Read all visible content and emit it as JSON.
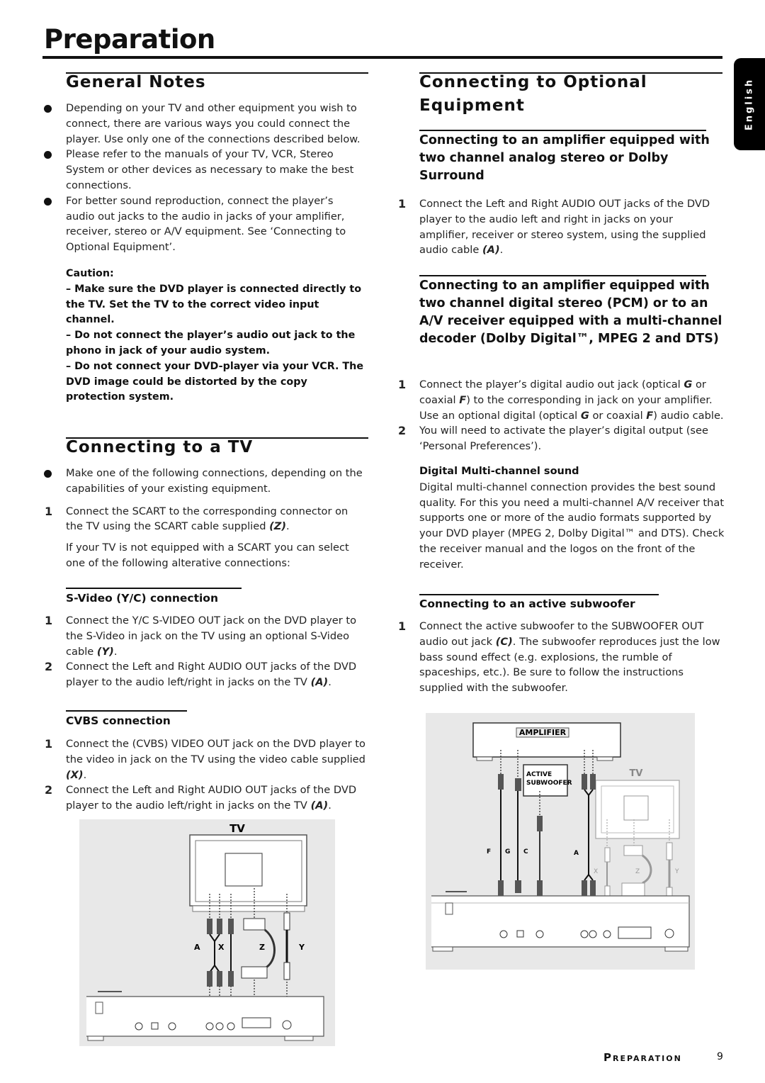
{
  "page": {
    "title": "Preparation",
    "language_tab": "English",
    "footer_section": "Preparation",
    "footer_page": "9"
  },
  "general_notes": {
    "heading": "General Notes",
    "bullets": [
      "Depending on your TV and other equipment you wish to connect, there are various ways you could connect the player. Use only one of the connections described below.",
      "Please refer to the manuals of your TV, VCR, Stereo System or other devices as necessary to make the best connections.",
      "For better sound reproduction, connect the player’s audio out jacks to the audio in jacks of your amplifier, receiver, stereo or A/V equipment.  See ‘Connecting to Optional Equipment’."
    ],
    "caution": {
      "label": "Caution:",
      "lines": [
        "– Make sure the DVD player is connected directly to the TV. Set the TV to the correct video input channel.",
        "–  Do not connect  the player’s audio out jack to the phono in jack of your audio system.",
        "–  Do not connect your DVD-player via your VCR. The DVD image could be distorted by the copy protection system."
      ]
    }
  },
  "connecting_tv": {
    "heading": "Connecting to a TV",
    "bullet": "Make one of the following connections, depending on the capabilities of your existing equipment.",
    "step1": {
      "num": "1",
      "text": "Connect the SCART to the corresponding connector on the TV using the SCART cable supplied ",
      "ref": "(Z)",
      "end": "."
    },
    "note": "If your TV is not equipped with a SCART you can select one of the following alterative connections:",
    "svideo": {
      "heading": "S-Video (Y/C) connection",
      "steps": [
        {
          "num": "1",
          "text": "Connect the Y/C S-VIDEO OUT jack on the DVD player to the S-Video in jack on the TV using an optional S-Video cable ",
          "ref": "(Y)",
          "end": "."
        },
        {
          "num": "2",
          "text": "Connect the Left and Right AUDIO OUT jacks of the DVD player to the audio left/right in jacks on the TV ",
          "ref": "(A)",
          "end": "."
        }
      ]
    },
    "cvbs": {
      "heading": "CVBS connection",
      "steps": [
        {
          "num": "1",
          "text": "Connect the (CVBS) VIDEO OUT jack on the DVD player to the video in jack on the TV using the video cable supplied ",
          "ref": "(X)",
          "end": "."
        },
        {
          "num": "2",
          "text": "Connect the Left and Right AUDIO OUT jacks of the DVD player to the audio left/right in jacks on the TV ",
          "ref": "(A)",
          "end": "."
        }
      ]
    },
    "diagram": {
      "tv_label": "TV",
      "cable_labels": [
        "A",
        "X",
        "Z",
        "Y"
      ]
    }
  },
  "optional_equipment": {
    "heading_line1": "Connecting to Optional",
    "heading_line2": "Equipment",
    "analog": {
      "heading": "Connecting to an amplifier equipped with two channel analog  stereo or Dolby Surround",
      "steps": [
        {
          "num": "1",
          "text": "Connect the Left and Right AUDIO OUT jacks of the DVD player to the audio left and right in jacks on your amplifier, receiver or stereo system, using the supplied audio cable ",
          "ref": "(A)",
          "end": "."
        }
      ]
    },
    "digital": {
      "heading": "Connecting to an amplifier equipped with two channel digital stereo (PCM) or to an A/V receiver equipped with a multi-channel decoder (Dolby Digital™, MPEG 2 and DTS)",
      "step1": {
        "num": "1",
        "a": "Connect the player’s digital audio out jack (optical ",
        "g1": "G",
        "b": " or coaxial ",
        "f1": "F",
        "c": ") to the corresponding in jack on your amplifier. Use an optional digital (optical ",
        "g2": "G",
        "d": " or coaxial ",
        "f2": "F",
        "e": ") audio cable."
      },
      "step2": {
        "num": "2",
        "text": "You will need to activate the player’s digital output (see ‘Personal Preferences’)."
      },
      "multichannel_heading": "Digital Multi-channel sound",
      "multichannel_text": "Digital multi-channel connection provides the best sound quality. For this you need a multi-channel A/V receiver that supports one or more of the audio formats supported by your DVD player (MPEG 2, Dolby Digital™ and DTS). Check the receiver manual and the logos on the front of the receiver."
    },
    "subwoofer": {
      "heading": "Connecting to an active subwoofer",
      "step1": {
        "num": "1",
        "a": "Connect the active subwoofer to the SUBWOOFER OUT audio out jack ",
        "ref": "(C)",
        "b": ". The subwoofer reproduces just the low bass sound effect (e.g. explosions, the rumble of spaceships, etc.). Be sure to follow the instructions supplied with the subwoofer."
      }
    },
    "diagram": {
      "amplifier_label": "AMPLIFIER",
      "subwoofer_label_1": "ACTIVE",
      "subwoofer_label_2": "SUBWOOFER",
      "tv_label": "TV",
      "cable_labels": [
        "F",
        "G",
        "C",
        "A",
        "X",
        "Z",
        "Y"
      ]
    }
  }
}
